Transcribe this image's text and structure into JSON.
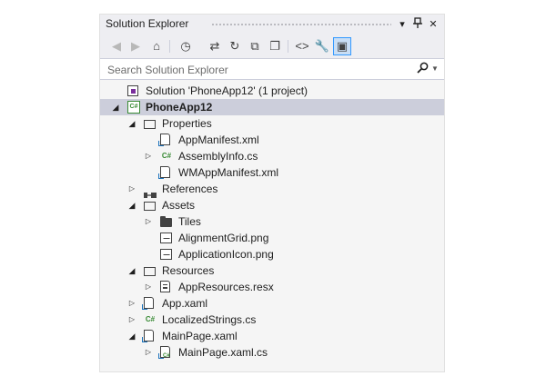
{
  "panel": {
    "title": "Solution Explorer",
    "controls": {
      "dropdown": "▾",
      "pin": "⊣",
      "close": "✕"
    }
  },
  "toolbar": {
    "buttons": [
      {
        "name": "back-icon",
        "glyph": "◀",
        "enabled": false
      },
      {
        "name": "forward-icon",
        "glyph": "▶",
        "enabled": false
      },
      {
        "name": "home-icon",
        "glyph": "⌂",
        "enabled": true
      },
      {
        "name": "pending-changes-filter-icon",
        "glyph": "◷",
        "enabled": true
      },
      {
        "name": "sync-with-active-document-icon",
        "glyph": "⇄",
        "enabled": true
      },
      {
        "name": "refresh-icon",
        "glyph": "↻",
        "enabled": true
      },
      {
        "name": "collapse-all-icon",
        "glyph": "⧉",
        "enabled": true
      },
      {
        "name": "show-all-files-icon",
        "glyph": "❐",
        "enabled": true
      },
      {
        "name": "view-code-icon",
        "glyph": "<>",
        "enabled": true
      },
      {
        "name": "properties-wrench-icon",
        "glyph": "🔧",
        "enabled": true
      },
      {
        "name": "preview-selected-items-icon",
        "glyph": "▣",
        "enabled": true,
        "active": true
      }
    ]
  },
  "search": {
    "placeholder": "Search Solution Explorer",
    "value": ""
  },
  "tree": [
    {
      "label": "Solution 'PhoneApp12' (1 project)",
      "icon": "solution-icon",
      "depth": 0,
      "state": "none",
      "bold": false,
      "selected": false
    },
    {
      "label": "PhoneApp12",
      "icon": "csharp-project-icon",
      "depth": 0,
      "state": "expanded",
      "bold": true,
      "selected": true
    },
    {
      "label": "Properties",
      "icon": "folder-open-icon",
      "depth": 1,
      "state": "expanded"
    },
    {
      "label": "AppManifest.xml",
      "icon": "xml-file-icon",
      "depth": 2,
      "state": "none"
    },
    {
      "label": "AssemblyInfo.cs",
      "icon": "csharp-file-icon",
      "depth": 2,
      "state": "collapsed"
    },
    {
      "label": "WMAppManifest.xml",
      "icon": "xml-file-icon",
      "depth": 2,
      "state": "none"
    },
    {
      "label": "References",
      "icon": "references-icon",
      "depth": 1,
      "state": "collapsed"
    },
    {
      "label": "Assets",
      "icon": "folder-open-icon",
      "depth": 1,
      "state": "expanded"
    },
    {
      "label": "Tiles",
      "icon": "folder-icon",
      "depth": 2,
      "state": "collapsed"
    },
    {
      "label": "AlignmentGrid.png",
      "icon": "image-file-icon",
      "depth": 2,
      "state": "none"
    },
    {
      "label": "ApplicationIcon.png",
      "icon": "image-file-icon",
      "depth": 2,
      "state": "none"
    },
    {
      "label": "Resources",
      "icon": "folder-open-icon",
      "depth": 1,
      "state": "expanded"
    },
    {
      "label": "AppResources.resx",
      "icon": "resx-file-icon",
      "depth": 2,
      "state": "collapsed"
    },
    {
      "label": "App.xaml",
      "icon": "xaml-file-icon",
      "depth": 1,
      "state": "collapsed"
    },
    {
      "label": "LocalizedStrings.cs",
      "icon": "csharp-file-icon",
      "depth": 1,
      "state": "collapsed"
    },
    {
      "label": "MainPage.xaml",
      "icon": "xaml-file-icon",
      "depth": 1,
      "state": "expanded"
    },
    {
      "label": "MainPage.xaml.cs",
      "icon": "csharp-linked-file-icon",
      "depth": 2,
      "state": "collapsed"
    }
  ],
  "colors": {
    "panel_bg": "#f5f5f5",
    "toolbar_bg": "#eeeef2",
    "selection_bg": "#cccedb",
    "csharp_green": "#388a34",
    "active_tool_border": "#3399ff"
  }
}
